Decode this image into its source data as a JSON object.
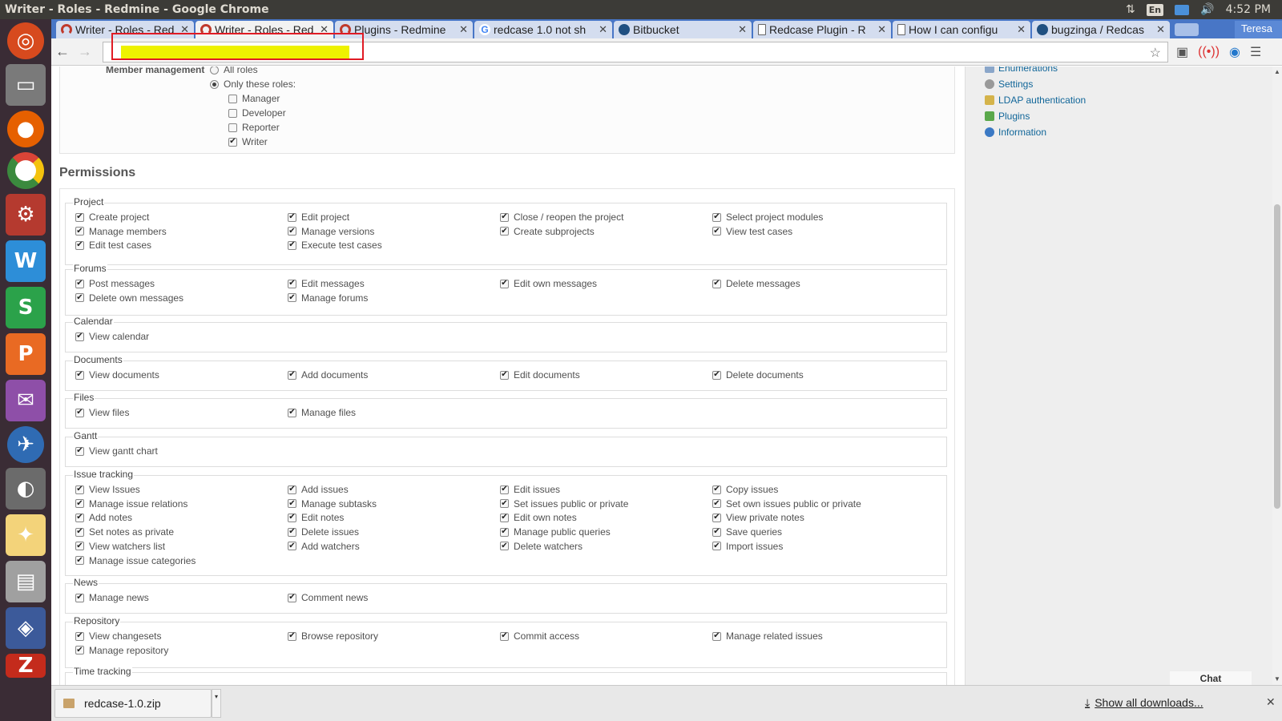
{
  "system": {
    "window_title": "Writer - Roles - Redmine - Google Chrome",
    "lang": "En",
    "clock": "4:52 PM",
    "user": "Teresa"
  },
  "tabs": [
    {
      "label": "Writer - Roles - Red",
      "favicon": "redmine-icon",
      "active": false
    },
    {
      "label": "Writer - Roles - Red",
      "favicon": "redmine-icon",
      "active": true
    },
    {
      "label": "Plugins - Redmine",
      "favicon": "redmine-icon",
      "active": false
    },
    {
      "label": "redcase 1.0 not sh",
      "favicon": "google-icon",
      "active": false
    },
    {
      "label": "Bitbucket",
      "favicon": "bitbucket-icon",
      "active": false
    },
    {
      "label": "Redcase Plugin - R",
      "favicon": "page-icon",
      "active": false
    },
    {
      "label": "How I can configu",
      "favicon": "page-icon",
      "active": false
    },
    {
      "label": "bugzinga / Redcas",
      "favicon": "bitbucket-icon",
      "active": false
    }
  ],
  "member_management": {
    "label": "Member management",
    "options": [
      {
        "label": "All roles",
        "selected": false
      },
      {
        "label": "Only these roles:",
        "selected": true
      }
    ],
    "roles": [
      {
        "label": "Manager",
        "checked": false
      },
      {
        "label": "Developer",
        "checked": false
      },
      {
        "label": "Reporter",
        "checked": false
      },
      {
        "label": "Writer",
        "checked": true
      }
    ]
  },
  "permissions": {
    "title": "Permissions",
    "groups": [
      {
        "name": "Project",
        "items": [
          "Create project",
          "Edit project",
          "Close / reopen the project",
          "Select project modules",
          "Manage members",
          "Manage versions",
          "Create subprojects",
          "View test cases",
          "Edit test cases",
          "Execute test cases"
        ]
      },
      {
        "name": "Forums",
        "items": [
          "Post messages",
          "Edit messages",
          "Edit own messages",
          "Delete messages",
          "Delete own messages",
          "Manage forums"
        ]
      },
      {
        "name": "Calendar",
        "items": [
          "View calendar"
        ]
      },
      {
        "name": "Documents",
        "items": [
          "View documents",
          "Add documents",
          "Edit documents",
          "Delete documents"
        ]
      },
      {
        "name": "Files",
        "items": [
          "View files",
          "Manage files"
        ]
      },
      {
        "name": "Gantt",
        "items": [
          "View gantt chart"
        ]
      },
      {
        "name": "Issue tracking",
        "items": [
          "View Issues",
          "Add issues",
          "Edit issues",
          "Copy issues",
          "Manage issue relations",
          "Manage subtasks",
          "Set issues public or private",
          "Set own issues public or private",
          "Add notes",
          "Edit notes",
          "Edit own notes",
          "View private notes",
          "Set notes as private",
          "Delete issues",
          "Manage public queries",
          "Save queries",
          "View watchers list",
          "Add watchers",
          "Delete watchers",
          "Import issues",
          "Manage issue categories"
        ]
      },
      {
        "name": "News",
        "items": [
          "Manage news",
          "Comment news"
        ]
      },
      {
        "name": "Repository",
        "items": [
          "View changesets",
          "Browse repository",
          "Commit access",
          "Manage related issues",
          "Manage repository"
        ]
      },
      {
        "name": "Time tracking",
        "items": []
      }
    ]
  },
  "sidebar": {
    "items": [
      {
        "label": "Enumerations",
        "icon": "list-icon"
      },
      {
        "label": "Settings",
        "icon": "gear-icon"
      },
      {
        "label": "LDAP authentication",
        "icon": "ldap-icon"
      },
      {
        "label": "Plugins",
        "icon": "puzzle-icon"
      },
      {
        "label": "Information",
        "icon": "info-icon"
      }
    ]
  },
  "chat": {
    "label": "Chat"
  },
  "downloads": {
    "file": "redcase-1.0.zip",
    "show_all": "Show all downloads..."
  }
}
